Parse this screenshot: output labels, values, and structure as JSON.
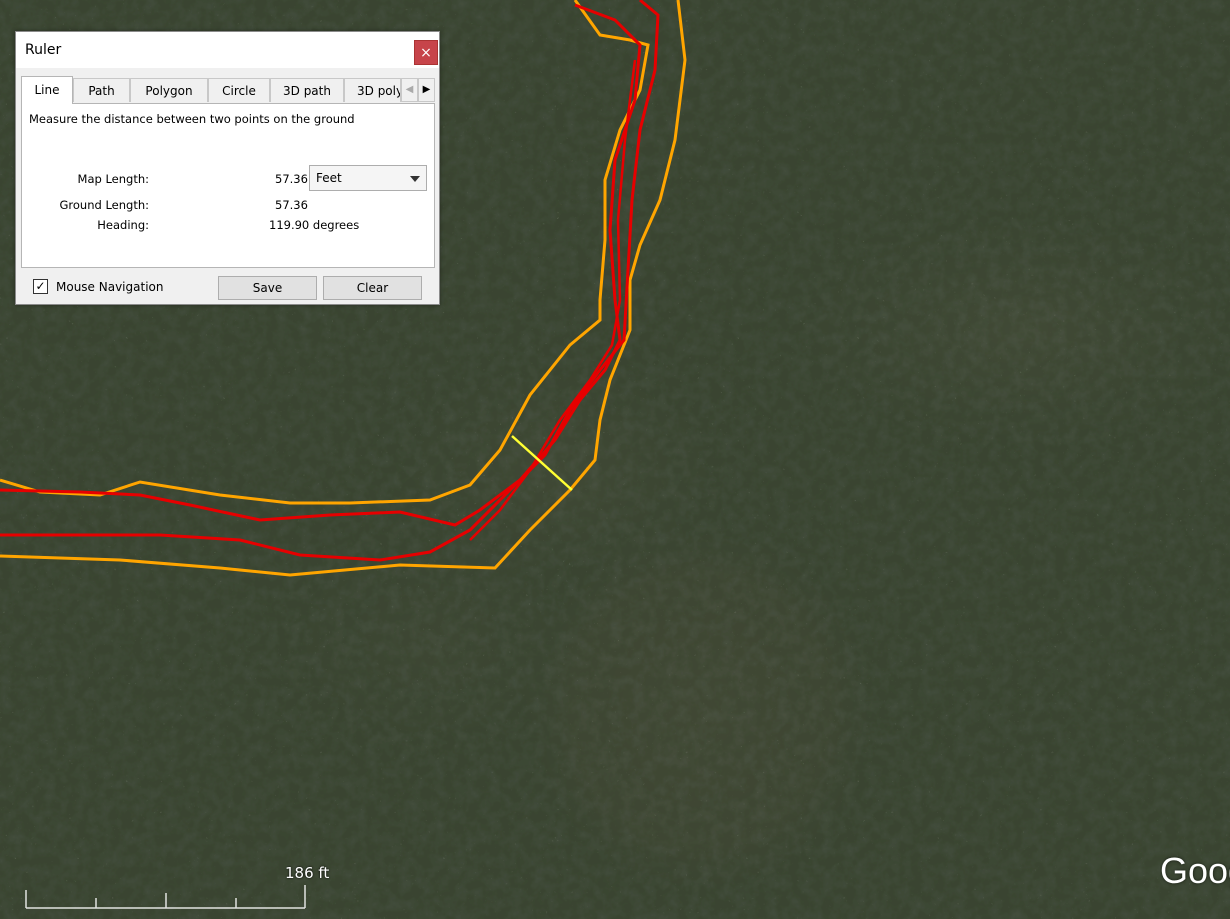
{
  "dialog": {
    "title": "Ruler",
    "close_glyph": "×",
    "tabs": [
      "Line",
      "Path",
      "Polygon",
      "Circle",
      "3D path",
      "3D poly"
    ],
    "active_tab": "Line",
    "description": "Measure the distance between two points on the ground",
    "map_length_label": "Map Length:",
    "map_length_value": "57.36",
    "unit_selected": "Feet",
    "ground_length_label": "Ground Length:",
    "ground_length_value": "57.36",
    "heading_label": "Heading:",
    "heading_value": "119.90 degrees",
    "mouse_nav_label": "Mouse Navigation",
    "mouse_nav_checked": true,
    "save_label": "Save",
    "clear_label": "Clear"
  },
  "map": {
    "scale_label": "186 ft",
    "logo_text": "Google",
    "colors": {
      "orange_path": "#ffa500",
      "red_path": "#e60000",
      "ruler_line": "#ffff33",
      "forest": "#2c3524",
      "clearing": "#6f604a"
    }
  }
}
